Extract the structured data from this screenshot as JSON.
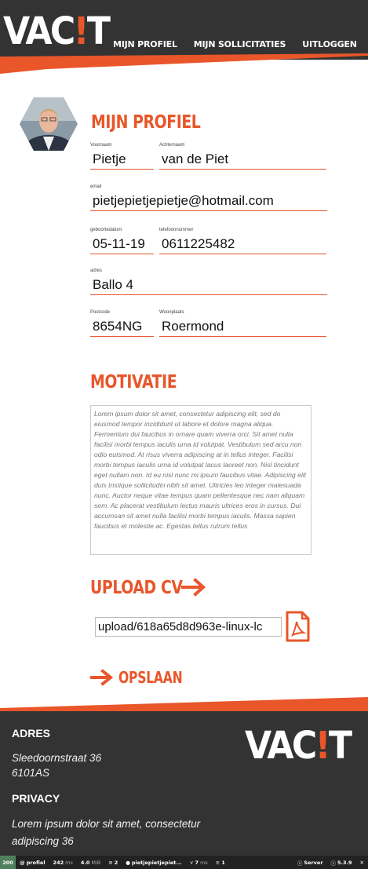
{
  "header": {
    "logo": {
      "prefix": "VAC",
      "bang": "!",
      "suffix": "T"
    },
    "nav": [
      {
        "label": "MIJN PROFIEL"
      },
      {
        "label": "MIJN SOLLICITATIES"
      },
      {
        "label": "UITLOGGEN"
      }
    ]
  },
  "profile": {
    "title": "MIJN PROFIEL",
    "fields": {
      "voornaam": {
        "label": "Voornaam",
        "value": "Pietje"
      },
      "achternaam": {
        "label": "Achternaam",
        "value": "van de Piet"
      },
      "email": {
        "label": "email",
        "value": "pietjepietjepietje@hotmail.com"
      },
      "geboortedatum": {
        "label": "geboortedatum",
        "value": "05-11-19"
      },
      "telefoonnummer": {
        "label": "telefoonnummer",
        "value": "0611225482"
      },
      "adres": {
        "label": "adres",
        "value": "Ballo 4"
      },
      "postcode": {
        "label": "Postcode",
        "value": "8654NG"
      },
      "woonplaats": {
        "label": "Woonplaats",
        "value": "Roermond"
      }
    }
  },
  "motivatie": {
    "title": "MOTIVATIE",
    "text": "Lorem ipsum dolor sit amet, consectetur adipiscing elit, sed do eiusmod tempor incididunt ut labore et dolore magna aliqua. Fermentum dui faucibus in ornare quam viverra orci. Sit amet nulla facilisi morbi tempus iaculis urna id volutpat. Vestibulum sed arcu non odio euismod. At risus viverra adipiscing at in tellus integer. Facilisi morbi tempus iaculis urna id volutpat lacus laoreet non. Nisl tincidunt eget nullam non. Id eu nisl nunc mi ipsum faucibus vitae. Adipiscing elit duis tristique sollicitudin nibh sit amet. Ultricies leo integer malesuada nunc. Auctor neque vitae tempus quam pellentesque nec nam aliquam sem. Ac placerat vestibulum lectus mauris ultrices eros in cursus. Dui accumsan sit amet nulla facilisi morbi tempus iaculis. Massa sapien faucibus et molestie ac. Egestas tellus rutrum tellus"
  },
  "upload": {
    "title": "UPLOAD CV",
    "value": "upload/618a65d8d963e-linux-lc"
  },
  "save": {
    "label": "OPSLAAN"
  },
  "footer": {
    "adres_title": "ADRES",
    "adres_line1": "Sleedoornstraat 36",
    "adres_line2": "6101AS",
    "privacy_title": "PRIVACY",
    "privacy_line1": "Lorem ipsum dolor sit amet, consectetur",
    "privacy_line2": "adipiscing 36",
    "logo": {
      "prefix": "VAC",
      "bang": "!",
      "suffix": "T"
    }
  },
  "toolbar": {
    "status": "200",
    "route": "@ profiel",
    "time": "242",
    "time_unit": "ms",
    "memory": "4.0",
    "memory_unit": "MiB",
    "layers": "2",
    "user": "pietjepietjepiet...",
    "twig_time": "7",
    "twig_unit": "ms",
    "db": "1",
    "server": "Server",
    "version": "5.3.9"
  },
  "colors": {
    "accent": "#e8562a",
    "dark": "#333333"
  }
}
